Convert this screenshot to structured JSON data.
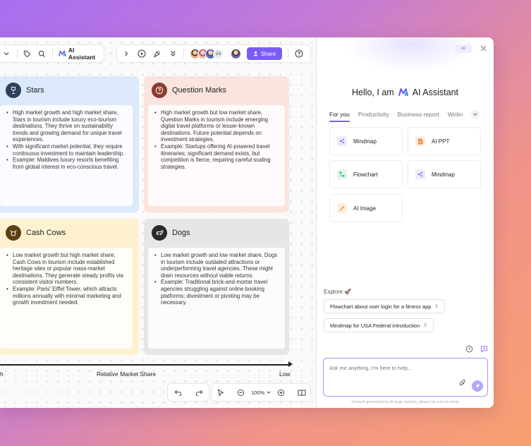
{
  "toolbar": {
    "ai_assistant_label": "AI Assistant",
    "avatar_count": "24",
    "share_label": "Share"
  },
  "matrix": {
    "stars": {
      "title": "Stars",
      "items": [
        "High market growth and high market share, Stars in tourism include luxury eco-tourism destinations. They thrive on sustainability trends and growing demand for unique travel experiences.",
        "With significant market potential, they require continuous investment to maintain leadership.",
        "Example: Maldives luxury resorts benefiting from global interest in eco-conscious travel."
      ]
    },
    "question_marks": {
      "title": "Question Marks",
      "items": [
        "High market growth but low market share, Question Marks in tourism include emerging digital travel platforms or lesser-known destinations. Future potential depends on investment strategies.",
        "Example: Startups offering AI-powered travel itineraries; significant demand exists, but competition is fierce, requiring careful scaling strategies."
      ]
    },
    "cash_cows": {
      "title": "Cash Cows",
      "items": [
        "Low market growth but high market share, Cash Cows in tourism include established heritage sites or popular mass-market destinations. They generate steady profits via consistent visitor numbers.",
        "Example: Paris' Eiffel Tower, which attracts millions annually with minimal marketing and growth investment needed."
      ]
    },
    "dogs": {
      "title": "Dogs",
      "items": [
        "Low market growth and low market share, Dogs in tourism include outdated attractions or underperforming travel agencies. These might drain resources without viable returns.",
        "Example: Traditional brick-and-mortar travel agencies struggling against online booking platforms; divestment or pivoting may be necessary."
      ]
    },
    "axis": {
      "left_label": "h",
      "center_label": "Relative Market Share",
      "right_label": "Low"
    }
  },
  "bottombar": {
    "zoom": "100%"
  },
  "assistant": {
    "badge": "oo",
    "greeting_prefix": "Hello, I am",
    "greeting_name": "AI Assistant",
    "tabs": [
      "For you",
      "Productivity",
      "Business report",
      "Writin"
    ],
    "cards": [
      {
        "label": "Mindmap",
        "icon": "mindmap-icon",
        "color": "#8b6cf0",
        "bg": "#efeafd"
      },
      {
        "label": "AI PPT",
        "icon": "ppt-icon",
        "color": "#f08a3c",
        "bg": "#fdeee2"
      },
      {
        "label": "Flowchart",
        "icon": "flowchart-icon",
        "color": "#3fbf7f",
        "bg": "#e3f6ec"
      },
      {
        "label": "Mindmap",
        "icon": "mindmap-icon",
        "color": "#8b6cf0",
        "bg": "#efeafd"
      },
      {
        "label": "AI Image",
        "icon": "ai-image-icon",
        "color": "#f08a3c",
        "bg": "#fdeee2"
      }
    ],
    "explore_label": "Explore 🚀",
    "suggestions": [
      "Flowchart about user login for a fitness app",
      "Mindmap for USA Federal introduction"
    ],
    "input_placeholder": "Ask me anything, I'm here to help...",
    "footer_note": "Content generated by AI large models, please be sure to verify"
  },
  "colors": {
    "accent": "#7c5cf5",
    "stars_bg": "#dbe9fb",
    "question_bg": "#fbe4de",
    "cash_bg": "#fdf1cf",
    "dogs_bg": "#e6e6e6"
  }
}
